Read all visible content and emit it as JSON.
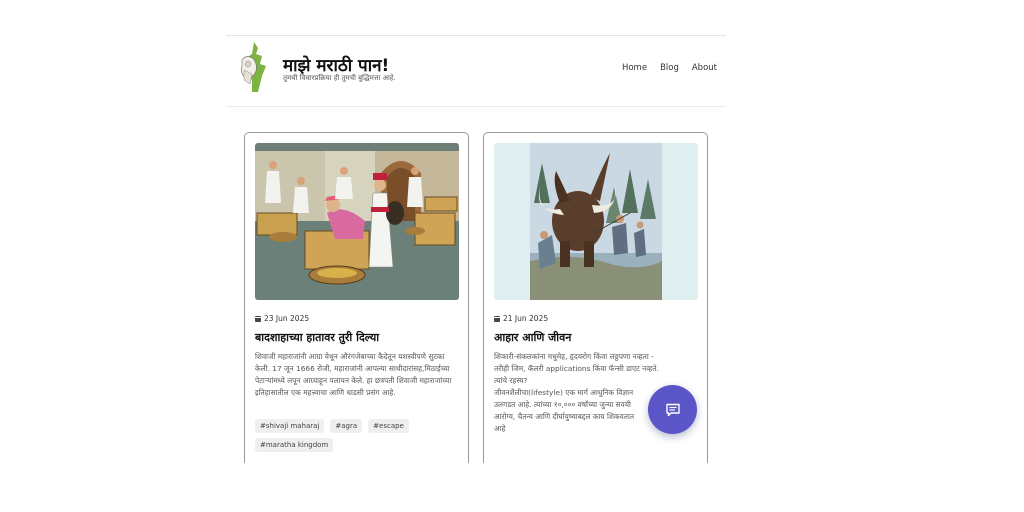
{
  "site": {
    "title": "माझे मराठी पान!",
    "tagline": "तुमची विचारप्रक्रिया ही तुमची बुद्धिमत्ता आहे."
  },
  "nav": {
    "items": [
      "Home",
      "Blog",
      "About"
    ]
  },
  "posts": [
    {
      "date": "23 Jun 2025",
      "title": "बादशाहाच्या हातावर तुरी दिल्या",
      "body": "शिवाजी महाराजांनी आग्रा येथून औरंगजेबाच्या कैदेतून यशस्वीपणे सुटका केली. 17 जून 1666 रोजी, महाराजांनी आपल्या साथीदारांसह,मिठाईच्या पेटाऱ्यांमध्ये लपून आग्र्याहून पलायन केले. हा छत्रपती शिवाजी महाराजांच्या इतिहासातील एक महत्त्वाचा आणि धाडसी प्रसंग आहे.",
      "tags": [
        "#shivaji maharaj",
        "#agra",
        "#escape",
        "#maratha kingdom"
      ],
      "image_icon": "palace-escape-illustration"
    },
    {
      "date": "21 Jun 2025",
      "title": "आहार आणि जीवन",
      "body_lines": [
        "शिकारी-संकलकांना मधुमेह, हृदयरोग किंवा लठ्ठपणा नव्हता -",
        "तरीही जिम, कॅलरी applications किंवा फॅन्सी डाएट नव्हते.",
        "त्यांचे रहस्य?",
        "जीवनशैलीचा(lifestyle) एक मार्ग आधुनिक विज्ञान",
        "उलगडत आहे. त्यांच्या १०,००० वर्षांच्या जुन्या सवयी",
        "आरोग्य, चैतन्य आणि दीर्घायुष्याबद्दल काय शिकवतात",
        "आहे"
      ],
      "image_icon": "mammoth-hunt-illustration"
    }
  ],
  "fab": {
    "icon": "chat-icon",
    "color": "#5b56c8"
  }
}
